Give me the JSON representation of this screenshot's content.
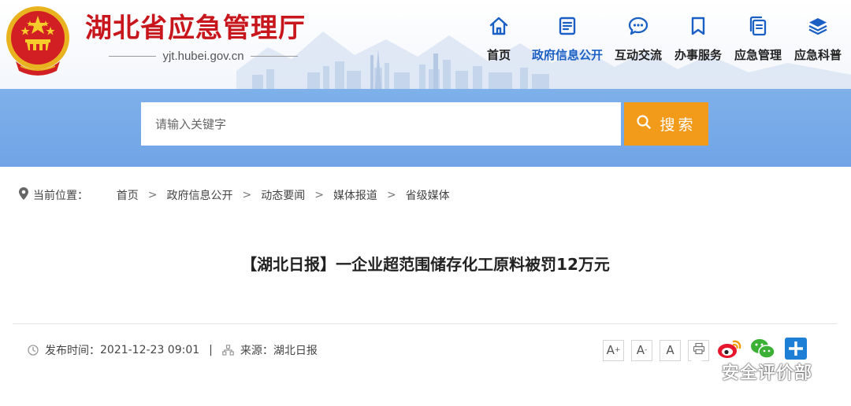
{
  "header": {
    "site_title": "湖北省应急管理厅",
    "domain": "yjt.hubei.gov.cn"
  },
  "nav": [
    {
      "label": "首页",
      "icon": "home-icon",
      "active": false
    },
    {
      "label": "政府信息公开",
      "icon": "document-icon",
      "active": true
    },
    {
      "label": "互动交流",
      "icon": "chat-bubble-icon",
      "active": false
    },
    {
      "label": "办事服务",
      "icon": "bookmark-icon",
      "active": false
    },
    {
      "label": "应急管理",
      "icon": "files-icon",
      "active": false
    },
    {
      "label": "应急科普",
      "icon": "layers-icon",
      "active": false
    }
  ],
  "search": {
    "placeholder": "请输入关键字",
    "button_label": "搜索"
  },
  "breadcrumb": {
    "prefix": "当前位置：",
    "items": [
      "首页",
      "政府信息公开",
      "动态要闻",
      "媒体报道",
      "省级媒体"
    ],
    "separator": ">"
  },
  "article": {
    "title": "【湖北日报】一企业超范围储存化工原料被罚12万元",
    "publish_label": "发布时间：",
    "publish_time": "2021-12-23 09:01",
    "meta_sep": "|",
    "source_label": "来源：",
    "source": "湖北日报"
  },
  "tools": {
    "font_large": "A",
    "font_medium": "A",
    "font_small": "A"
  },
  "watermark": {
    "text": "安全评价部"
  },
  "colors": {
    "brand_red": "#c8161d",
    "nav_active": "#1a5fc4",
    "search_band": "#7fb0ea",
    "search_button": "#f29a1a"
  }
}
